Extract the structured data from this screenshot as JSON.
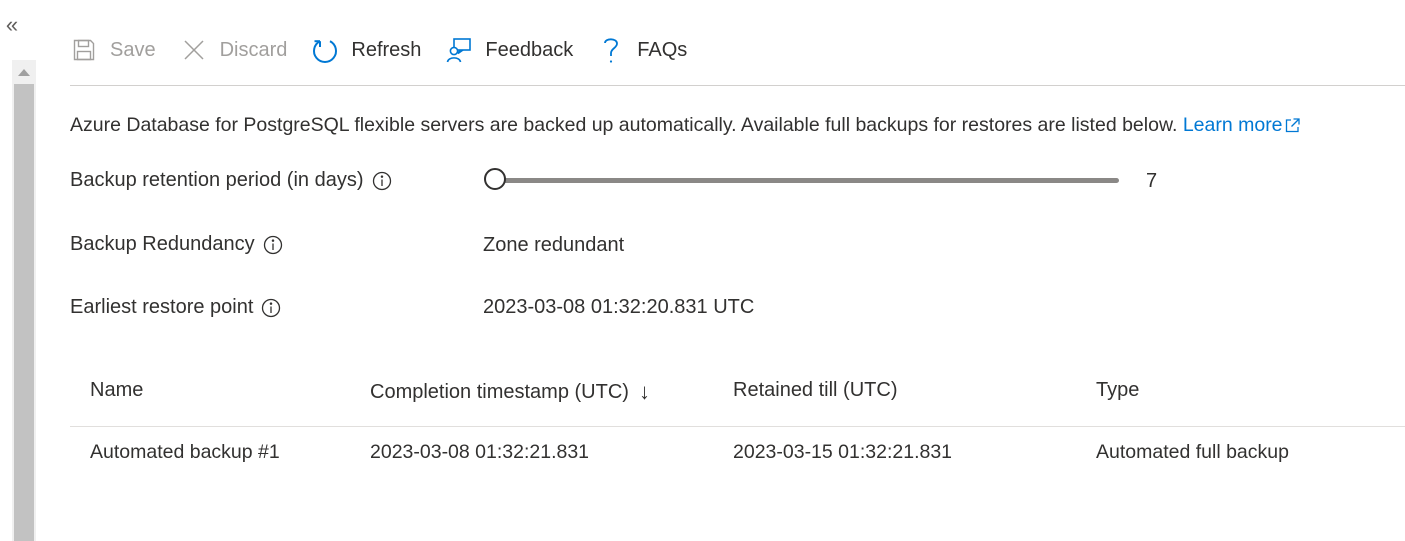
{
  "nav": {
    "collapse_glyph": "«"
  },
  "toolbar": {
    "items": [
      {
        "label": "Save",
        "icon": "save-icon",
        "enabled": false
      },
      {
        "label": "Discard",
        "icon": "close-icon",
        "enabled": false
      },
      {
        "label": "Refresh",
        "icon": "refresh-icon",
        "enabled": true
      },
      {
        "label": "Feedback",
        "icon": "feedback-icon",
        "enabled": true
      },
      {
        "label": "FAQs",
        "icon": "question-icon",
        "enabled": true
      }
    ]
  },
  "description": {
    "text": "Azure Database for PostgreSQL flexible servers are backed up automatically. Available full backups for restores are listed below.",
    "link_label": "Learn more"
  },
  "retention": {
    "label": "Backup retention period (in days)",
    "value": "7",
    "slider_fraction": 0.0
  },
  "redundancy": {
    "label": "Backup Redundancy",
    "value": "Zone redundant"
  },
  "restore_point": {
    "label": "Earliest restore point",
    "value": "2023-03-08 01:32:20.831 UTC"
  },
  "table": {
    "columns": [
      {
        "label": "Name",
        "sorted": ""
      },
      {
        "label": "Completion timestamp (UTC)",
        "sorted": "↓"
      },
      {
        "label": "Retained till (UTC)",
        "sorted": ""
      },
      {
        "label": "Type",
        "sorted": ""
      }
    ],
    "rows": [
      {
        "name": "Automated backup #1",
        "completion": "2023-03-08 01:32:21.831",
        "retained": "2023-03-15 01:32:21.831",
        "type": "Automated full backup"
      }
    ]
  },
  "colors": {
    "accent": "#0078d4",
    "text": "#323130",
    "disabled": "#a19f9d"
  }
}
